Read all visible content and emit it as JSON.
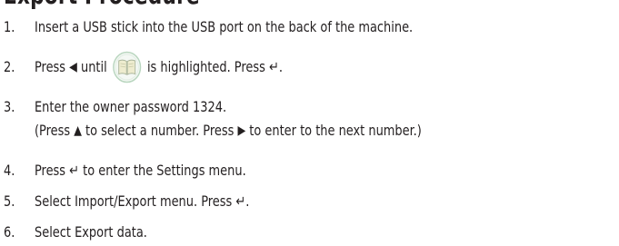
{
  "heading": "Export Procedure",
  "steps": [
    {
      "num": "1.",
      "text": "Insert a USB stick into the USB port on the back of the machine."
    },
    {
      "num": "2.",
      "pre": "Press",
      "left_arrow": "◀",
      "mid": "until",
      "icon": "book-icon",
      "post": "is highlighted. Press",
      "enter": "↵",
      "end": "."
    },
    {
      "num": "3.",
      "line1": "Enter the owner password 1324.",
      "line2_a": "(Press",
      "up_arrow": "▲",
      "line2_b": "to select a number. Press",
      "right_arrow": "▶",
      "line2_c": "to enter to the next number.)"
    },
    {
      "num": "4.",
      "pre": "Press",
      "enter": "↵",
      "post": " to enter the Settings menu."
    },
    {
      "num": "5.",
      "pre": "Select Import/Export menu. Press",
      "enter": "↵",
      "end": "."
    },
    {
      "num": "6.",
      "text": "Select Export data."
    }
  ],
  "colors": {
    "text": "#231f20",
    "icon_ring": "#cfe3d2",
    "icon_book": "#e9e6c8"
  }
}
